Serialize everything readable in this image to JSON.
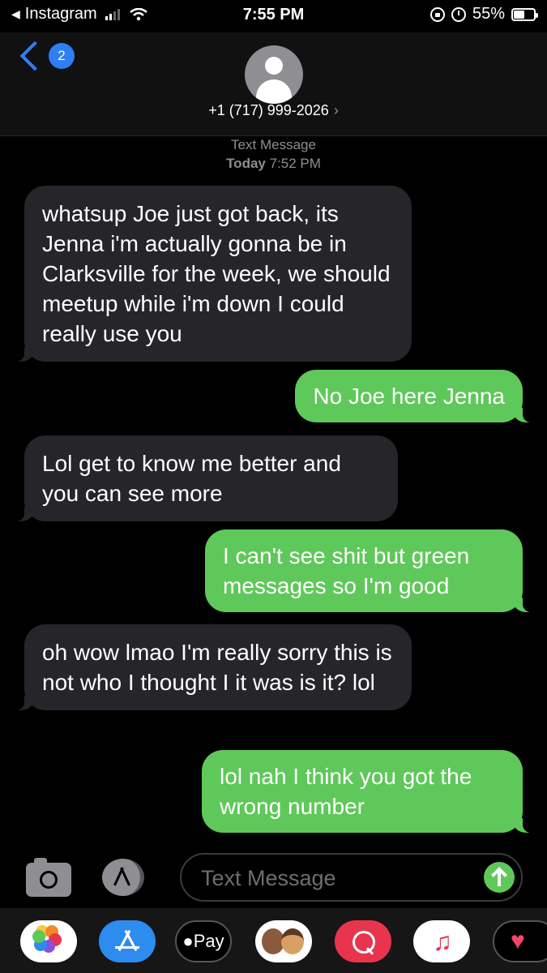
{
  "status_bar": {
    "back_app": "Instagram",
    "time": "7:55 PM",
    "battery_percent": "55%",
    "battery_level": 0.55
  },
  "header": {
    "unread_count": "2",
    "contact_number": "+1 (717) 999-2026",
    "contact_chevron": "›"
  },
  "thread": {
    "service": "Text Message",
    "date_label": "Today",
    "time_label": "7:52 PM"
  },
  "messages": [
    {
      "direction": "incoming",
      "text": "whatsup Joe just got back, its Jenna i'm actually gonna be in Clarksville for the week, we should meetup while i'm down I could really use you"
    },
    {
      "direction": "outgoing",
      "text": "No Joe here Jenna"
    },
    {
      "direction": "incoming",
      "text": "Lol get to know me better and you can see more"
    },
    {
      "direction": "outgoing",
      "text": "I can't see shit but green messages so I'm good"
    },
    {
      "direction": "incoming",
      "text": "oh wow lmao I'm really sorry this is not who I thought I it was is it? lol"
    },
    {
      "direction": "outgoing",
      "text": "lol nah I think you got the wrong number"
    }
  ],
  "input_bar": {
    "placeholder": "Text Message"
  },
  "app_drawer": {
    "apple_pay_label": "Pay",
    "apps": [
      "photos-icon",
      "app-store-icon",
      "apple-pay-icon",
      "memoji-icon",
      "search-icon",
      "music-icon",
      "digital-touch-icon"
    ]
  },
  "colors": {
    "incoming_bubble": "#26252a",
    "outgoing_bubble": "#5fc85a",
    "accent_blue": "#2f7ef6"
  }
}
